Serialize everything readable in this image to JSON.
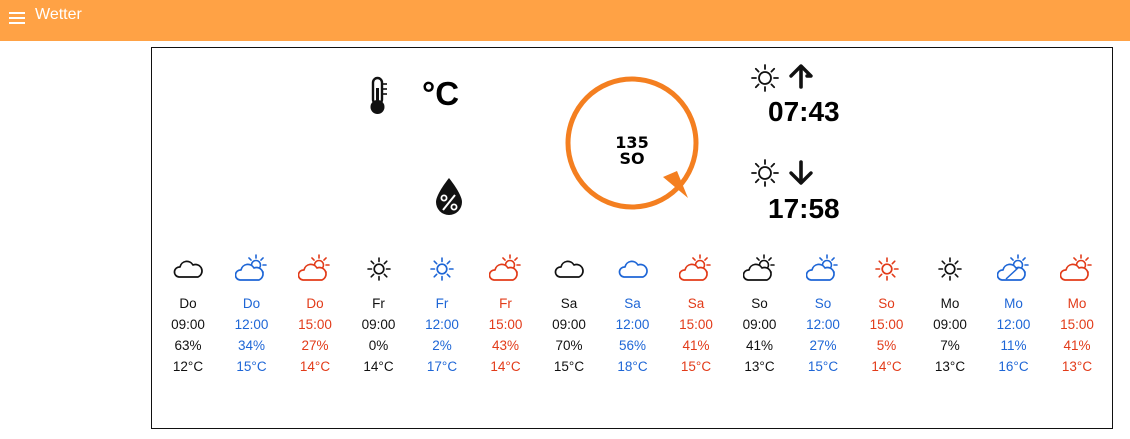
{
  "app": {
    "title": "Wetter",
    "menu_icon": "hamburger-menu-icon"
  },
  "colors": {
    "header": "#ffa245",
    "accent": "#f47f20",
    "black": "#111111",
    "blue": "#1e66d6",
    "red": "#e23b19"
  },
  "current": {
    "temperature_unit": "°C",
    "temperature_icon": "thermometer-icon",
    "humidity_icon": "humidity-drop-icon",
    "wind": {
      "degrees": "135",
      "direction": "SO"
    }
  },
  "sun": {
    "sunrise": {
      "time": "07:43",
      "icon": "sun-icon",
      "arrow": "arrow-up-icon"
    },
    "sunset": {
      "time": "17:58",
      "icon": "sun-icon",
      "arrow": "arrow-down-icon"
    }
  },
  "forecast": [
    {
      "day": "Do",
      "time": "09:00",
      "precip": "63%",
      "temp": "12°C",
      "color": "black",
      "icon": "cloudy-icon"
    },
    {
      "day": "Do",
      "time": "12:00",
      "precip": "34%",
      "temp": "15°C",
      "color": "blue",
      "icon": "partly-cloudy-icon"
    },
    {
      "day": "Do",
      "time": "15:00",
      "precip": "27%",
      "temp": "14°C",
      "color": "red",
      "icon": "partly-cloudy-icon"
    },
    {
      "day": "Fr",
      "time": "09:00",
      "precip": "0%",
      "temp": "14°C",
      "color": "black",
      "icon": "sunny-icon"
    },
    {
      "day": "Fr",
      "time": "12:00",
      "precip": "2%",
      "temp": "17°C",
      "color": "blue",
      "icon": "sunny-icon"
    },
    {
      "day": "Fr",
      "time": "15:00",
      "precip": "43%",
      "temp": "14°C",
      "color": "red",
      "icon": "partly-cloudy-icon"
    },
    {
      "day": "Sa",
      "time": "09:00",
      "precip": "70%",
      "temp": "15°C",
      "color": "black",
      "icon": "cloudy-icon"
    },
    {
      "day": "Sa",
      "time": "12:00",
      "precip": "56%",
      "temp": "18°C",
      "color": "blue",
      "icon": "cloudy-icon"
    },
    {
      "day": "Sa",
      "time": "15:00",
      "precip": "41%",
      "temp": "15°C",
      "color": "red",
      "icon": "partly-cloudy-icon"
    },
    {
      "day": "So",
      "time": "09:00",
      "precip": "41%",
      "temp": "13°C",
      "color": "black",
      "icon": "partly-cloudy-icon"
    },
    {
      "day": "So",
      "time": "12:00",
      "precip": "27%",
      "temp": "15°C",
      "color": "blue",
      "icon": "partly-cloudy-icon"
    },
    {
      "day": "So",
      "time": "15:00",
      "precip": "5%",
      "temp": "14°C",
      "color": "red",
      "icon": "sunny-icon"
    },
    {
      "day": "Mo",
      "time": "09:00",
      "precip": "7%",
      "temp": "13°C",
      "color": "black",
      "icon": "sunny-icon"
    },
    {
      "day": "Mo",
      "time": "12:00",
      "precip": "11%",
      "temp": "16°C",
      "color": "blue",
      "icon": "sun-behind-cloud-icon"
    },
    {
      "day": "Mo",
      "time": "15:00",
      "precip": "41%",
      "temp": "13°C",
      "color": "red",
      "icon": "partly-cloudy-icon"
    }
  ]
}
